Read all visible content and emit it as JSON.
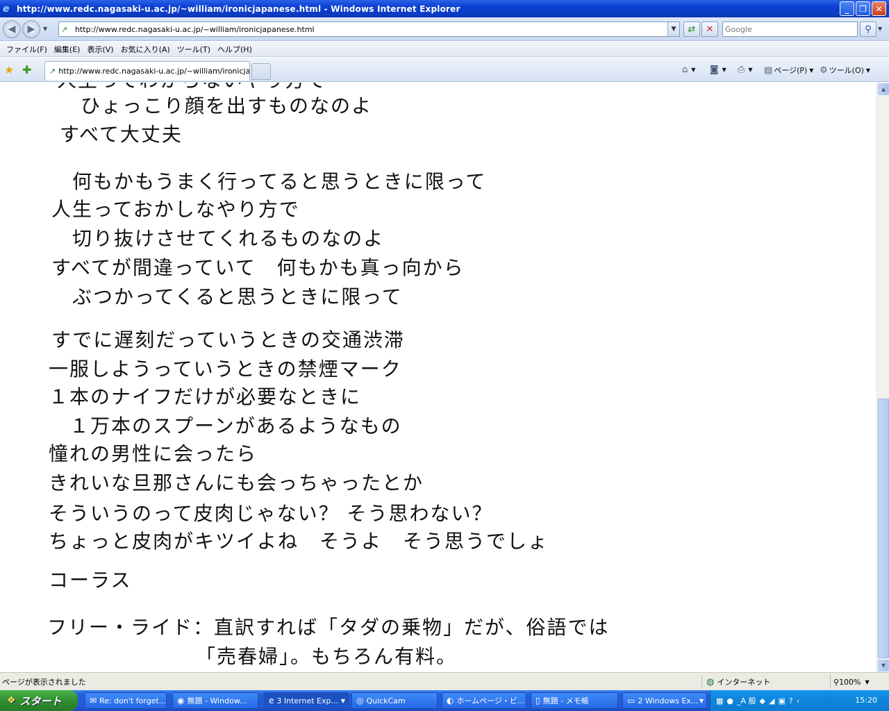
{
  "window": {
    "title": "http://www.redc.nagasaki-u.ac.jp/~william/ironicjapanese.html - Windows Internet Explorer",
    "minimize": "_",
    "maximize": "❐",
    "close": "✕"
  },
  "address_bar": {
    "url": "http://www.redc.nagasaki-u.ac.jp/~william/ironicjapanese.html",
    "search_placeholder": "Google"
  },
  "menu": [
    "ファイル(F)",
    "編集(E)",
    "表示(V)",
    "お気に入り(A)",
    "ツール(T)",
    "ヘルプ(H)"
  ],
  "tab": {
    "title": "http://www.redc.nagasaki-u.ac.jp/~william/ironicjap..."
  },
  "commands": {
    "page": "ページ(P)",
    "tools": "ツール(O)"
  },
  "lyrics": [
    "人生ってわからないやり方で",
    "ひょっこり顔を出すものなのよ",
    "すべて大丈夫",
    "何もかもうまく行ってると思うときに限って",
    "人生っておかしなやり方で",
    "切り抜けさせてくれるものなのよ",
    "すべてが間違っていて　何もかも真っ向から",
    "ぶつかってくると思うときに限って",
    "すでに遅刻だっていうときの交通渋滞",
    "一服しようっていうときの禁煙マーク",
    "１本のナイフだけが必要なときに",
    "１万本のスプーンがあるようなもの",
    "憧れの男性に会ったら",
    "きれいな旦那さんにも会っちゃったとか",
    "そういうのって皮肉じゃない？ そう思わない？",
    "ちょっと皮肉がキツイよね　そうよ　そう思うでしょ",
    "コーラス",
    "フリー・ライド：直訳すれば「タダの乗物」だが、俗語では",
    "「売春婦」。もちろん有料。"
  ],
  "status": {
    "text": "ページが表示されました",
    "zone": "インターネット",
    "zoom": "100%"
  },
  "taskbar": {
    "start": "スタート",
    "tasks": [
      "Re: don't forget...",
      "無題 - Window...",
      "3 Internet Exp...",
      "QuickCam",
      "ホームページ・ビ...",
      "無題 - メモ帳",
      "2 Windows Ex..."
    ],
    "tray_label": "_A 般",
    "clock": "15:20"
  },
  "icons": [
    "ie-icon",
    "back-icon",
    "forward-icon",
    "refresh-icon",
    "stop-icon",
    "search-icon",
    "favorites-star-icon",
    "add-favorite-icon",
    "home-icon",
    "feeds-icon",
    "print-icon",
    "page-icon",
    "tools-gear-icon",
    "globe-icon",
    "zoom-icon",
    "windows-logo-icon"
  ]
}
